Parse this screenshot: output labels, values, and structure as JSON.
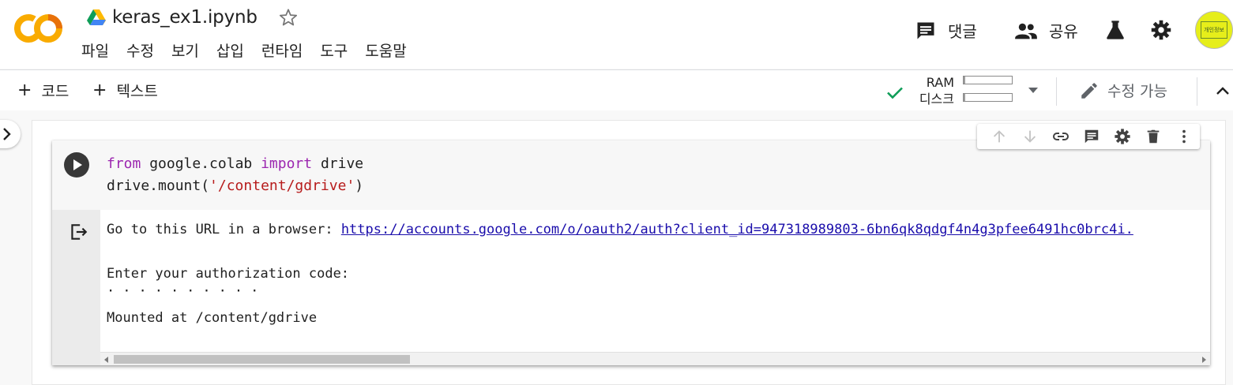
{
  "header": {
    "doc_title": "keras_ex1.ipynb",
    "logo_text": "CO",
    "menu": [
      {
        "label": "파일"
      },
      {
        "label": "수정"
      },
      {
        "label": "보기"
      },
      {
        "label": "삽입"
      },
      {
        "label": "런타임"
      },
      {
        "label": "도구"
      },
      {
        "label": "도움말"
      }
    ],
    "actions": {
      "comment_label": "댓글",
      "share_label": "공유"
    },
    "avatar_text": "개인정보"
  },
  "toolbar": {
    "add_code_label": "코드",
    "add_text_label": "텍스트",
    "ram_label": "RAM",
    "disk_label": "디스크",
    "ram_usage": 0.04,
    "disk_usage": 0.04,
    "edit_label": "수정 가능",
    "status_color": "#0f9d58"
  },
  "cell": {
    "code_line1_kw1": "from",
    "code_line1_mod": " google.colab ",
    "code_line1_kw2": "import",
    "code_line1_name": " drive",
    "code_line2_pre": "drive.mount(",
    "code_line2_str": "'/content/gdrive'",
    "code_line2_post": ")",
    "output": {
      "line1_prefix": "Go to this URL in a browser: ",
      "line1_url": "https://accounts.google.com/o/oauth2/auth?client_id=947318989803-6bn6qk8qdgf4n4g3pfee6491hc0brc4i.",
      "line2": "Enter your authorization code:",
      "line3": "··········",
      "line4": "Mounted at /content/gdrive"
    },
    "scroll_position": 0.0
  },
  "icons": {
    "logo": "colab-logo",
    "drive": "google-drive-icon",
    "star": "star-outline-icon",
    "comment": "comment-icon",
    "share": "people-icon",
    "lab": "flask-icon",
    "settings": "gear-icon",
    "check": "check-icon",
    "edit": "pencil-icon"
  },
  "colors": {
    "logo_orange": "#f9ab00",
    "logo_dark": "#e8710a",
    "keyword": "#9c27b0",
    "string": "#b71c1c",
    "link": "#1a0dab"
  }
}
